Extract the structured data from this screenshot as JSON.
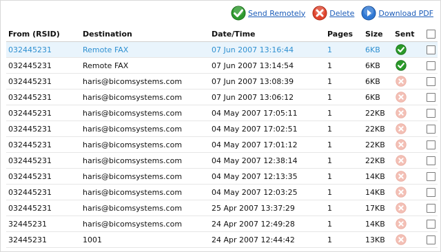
{
  "toolbar": {
    "send_label": "Send Remotely",
    "delete_label": "Delete",
    "download_label": "Download PDF"
  },
  "columns": {
    "from": "From (RSID)",
    "destination": "Destination",
    "datetime": "Date/Time",
    "pages": "Pages",
    "size": "Size",
    "sent": "Sent"
  },
  "colors": {
    "accent": "#2e8fd0",
    "link": "#1a5bb8",
    "sent_ok": "#2a9a2a",
    "sent_fail": "#f2b7ae"
  },
  "rows": [
    {
      "from": "032445231",
      "destination": "Remote FAX",
      "datetime": "07 Jun 2007 13:16:44",
      "pages": "1",
      "size": "6KB",
      "sent": "check-icon",
      "selected": true
    },
    {
      "from": "032445231",
      "destination": "Remote FAX",
      "datetime": "07 Jun 2007 13:14:54",
      "pages": "1",
      "size": "6KB",
      "sent": "check-icon",
      "selected": false
    },
    {
      "from": "032445231",
      "destination": "haris@bicomsystems.com",
      "datetime": "07 Jun 2007 13:08:39",
      "pages": "1",
      "size": "6KB",
      "sent": "fail-icon",
      "selected": false
    },
    {
      "from": "032445231",
      "destination": "haris@bicomsystems.com",
      "datetime": "07 Jun 2007 13:06:12",
      "pages": "1",
      "size": "6KB",
      "sent": "fail-icon",
      "selected": false
    },
    {
      "from": "032445231",
      "destination": "haris@bicomsystems.com",
      "datetime": "04 May 2007 17:05:11",
      "pages": "1",
      "size": "22KB",
      "sent": "fail-icon",
      "selected": false
    },
    {
      "from": "032445231",
      "destination": "haris@bicomsystems.com",
      "datetime": "04 May 2007 17:02:51",
      "pages": "1",
      "size": "22KB",
      "sent": "fail-icon",
      "selected": false
    },
    {
      "from": "032445231",
      "destination": "haris@bicomsystems.com",
      "datetime": "04 May 2007 17:01:12",
      "pages": "1",
      "size": "22KB",
      "sent": "fail-icon",
      "selected": false
    },
    {
      "from": "032445231",
      "destination": "haris@bicomsystems.com",
      "datetime": "04 May 2007 12:38:14",
      "pages": "1",
      "size": "22KB",
      "sent": "fail-icon",
      "selected": false
    },
    {
      "from": "032445231",
      "destination": "haris@bicomsystems.com",
      "datetime": "04 May 2007 12:13:35",
      "pages": "1",
      "size": "14KB",
      "sent": "fail-icon",
      "selected": false
    },
    {
      "from": "032445231",
      "destination": "haris@bicomsystems.com",
      "datetime": "04 May 2007 12:03:25",
      "pages": "1",
      "size": "14KB",
      "sent": "fail-icon",
      "selected": false
    },
    {
      "from": "032445231",
      "destination": "haris@bicomsystems.com",
      "datetime": "25 Apr 2007 13:37:29",
      "pages": "1",
      "size": "17KB",
      "sent": "fail-icon",
      "selected": false
    },
    {
      "from": "32445231",
      "destination": "haris@bicomsystems.com",
      "datetime": "24 Apr 2007 12:49:28",
      "pages": "1",
      "size": "14KB",
      "sent": "fail-icon",
      "selected": false
    },
    {
      "from": "32445231",
      "destination": "1001",
      "datetime": "24 Apr 2007 12:44:42",
      "pages": "1",
      "size": "13KB",
      "sent": "fail-icon",
      "selected": false
    }
  ]
}
